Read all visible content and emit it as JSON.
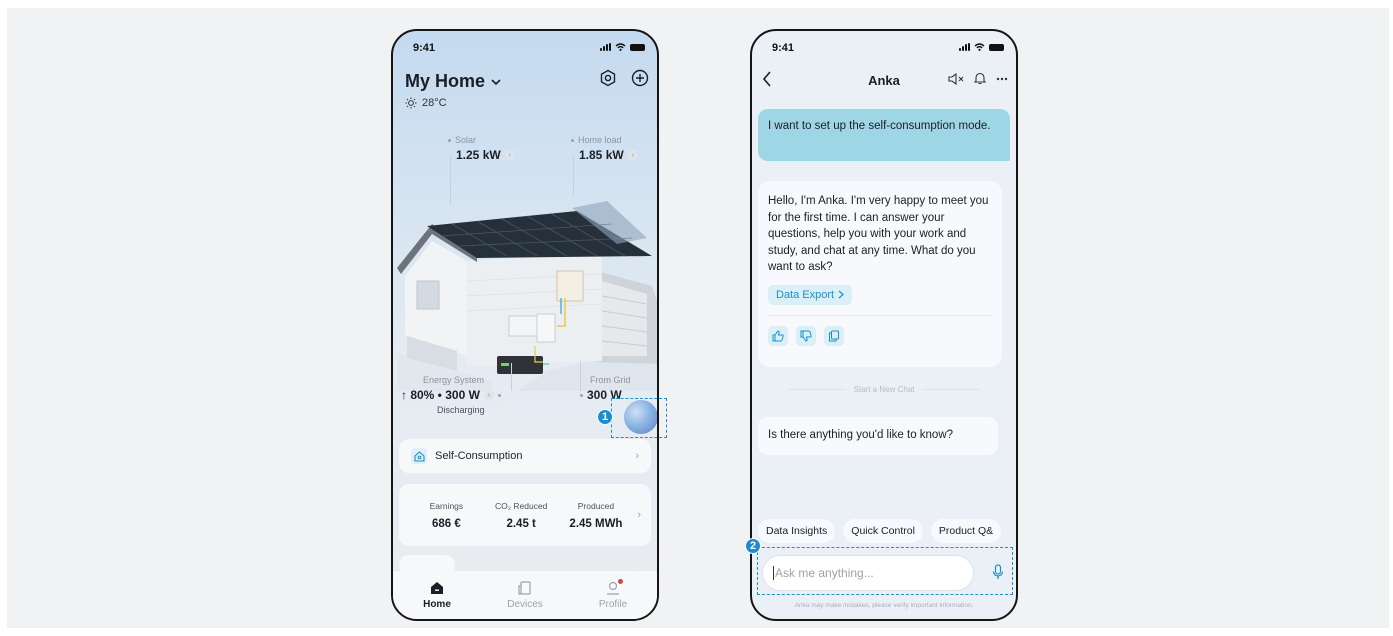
{
  "phone1": {
    "status_time": "9:41",
    "home_title": "My Home",
    "weather": "28°C",
    "solar": {
      "label": "Solar",
      "value": "1.25 kW"
    },
    "home_load": {
      "label": "Home load",
      "value": "1.85 kW"
    },
    "energy_system": {
      "label": "Energy System",
      "value": "↑ 80% • 300 W",
      "status": "Discharging"
    },
    "from_grid": {
      "label": "From Grid",
      "value": "300 W"
    },
    "callout_1": "1",
    "mode_card": {
      "label": "Self-Consumption"
    },
    "stats": [
      {
        "label": "Earnings",
        "value": "686 €"
      },
      {
        "label": "CO₂ Reduced",
        "value": "2.45 t"
      },
      {
        "label": "Produced",
        "value": "2.45 MWh"
      }
    ],
    "tabs": [
      {
        "label": "Home",
        "icon": "home-icon",
        "active": true
      },
      {
        "label": "Devices",
        "icon": "devices-icon",
        "active": false
      },
      {
        "label": "Profile",
        "icon": "profile-icon",
        "active": false
      }
    ],
    "colors": {
      "accent": "#1a8fd0",
      "notification": "#e0403a"
    }
  },
  "phone2": {
    "status_time": "9:41",
    "title": "Anka",
    "user_message": "I want to set up the self-consumption mode.",
    "bot_message": "Hello, I'm Anka. I'm very happy to meet you for the first time. I can answer your questions, help you with your work and study, and chat at any time. What do you want to ask?",
    "data_export_link": "Data Export",
    "new_chat_divider": "Start a New Chat",
    "bot_message_2": "Is there anything you'd like to know?",
    "quick_chips": [
      "Data Insights",
      "Quick Control",
      "Product Q&"
    ],
    "callout_2": "2",
    "input_placeholder": "Ask me anything...",
    "disclaimer": "Anka may make mistakes, please verify important information.",
    "colors": {
      "user_bubble": "#9fd6e6",
      "link": "#1a8fd0"
    }
  }
}
